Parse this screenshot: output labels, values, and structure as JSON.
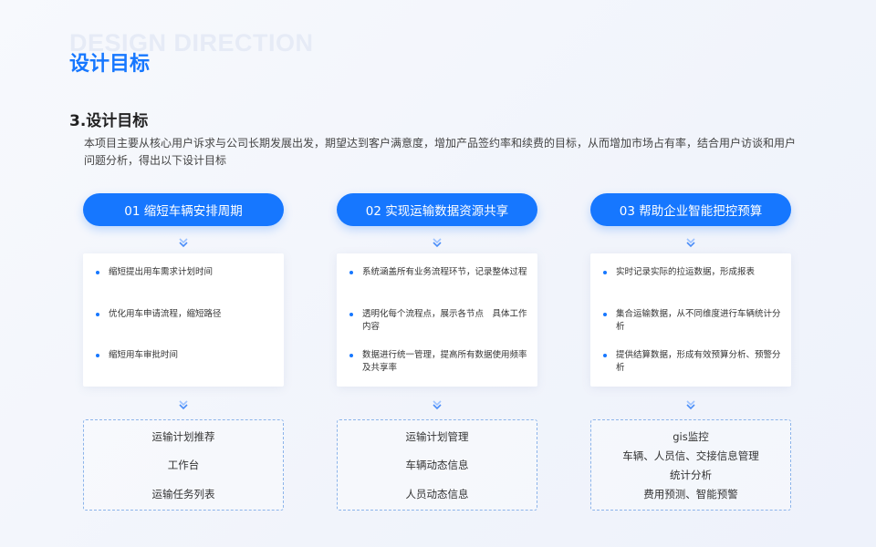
{
  "header": {
    "watermark": "DESIGN DIRECTION",
    "title": "设计目标"
  },
  "section": {
    "title": "3.设计目标",
    "intro": "本项目主要从核心用户诉求与公司长期发展出发，期望达到客户满意度，增加产品签约率和续费的目标，从而增加市场占有率，结合用户访谈和用户问题分析，得出以下设计目标"
  },
  "columns": [
    {
      "title": "01 缩短车辆安排周期",
      "bullets": [
        "缩短提出用车需求计划时间",
        "优化用车申请流程，缩短路径",
        "缩短用车审批时间"
      ],
      "modules": [
        "运输计划推荐",
        "工作台",
        "运输任务列表"
      ]
    },
    {
      "title": "02 实现运输数据资源共享",
      "bullets": [
        "系统涵盖所有业务流程环节，记录整体过程",
        "透明化每个流程点，展示各节点　具体工作内容",
        "数据进行统一管理，提高所有数据使用频率及共享率"
      ],
      "modules": [
        "运输计划管理",
        "车辆动态信息",
        "人员动态信息"
      ]
    },
    {
      "title": "03 帮助企业智能把控预算",
      "bullets": [
        "实时记录实际的拉运数据，形成报表",
        "集合运输数据，从不同维度进行车辆统计分析",
        "提供结算数据，形成有效预算分析、预警分析"
      ],
      "modules": [
        "gis监控",
        "车辆、人员信、交接信息管理",
        "统计分析",
        "费用预测、智能预警"
      ]
    }
  ],
  "colors": {
    "accent": "#1677ff",
    "arrow": "#5b9bff",
    "dashed_border": "#8cb4ea"
  },
  "icons": {
    "arrow": "double-chevron-down-icon",
    "bullet": "bullet-dot-icon"
  }
}
